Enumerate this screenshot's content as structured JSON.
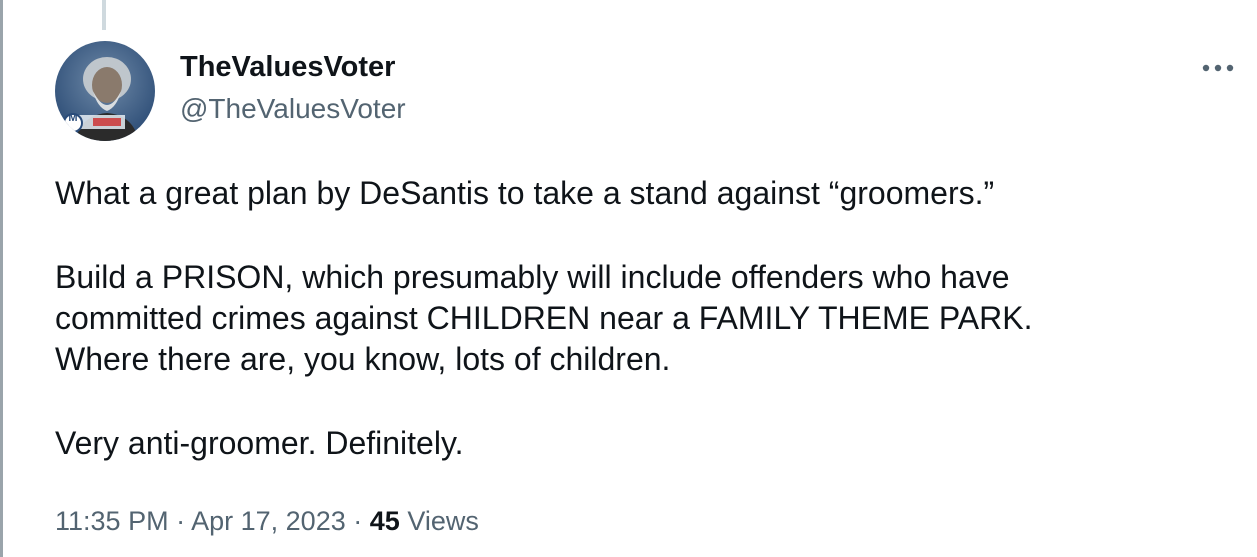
{
  "author": {
    "display_name": "TheValuesVoter",
    "handle": "@TheValuesVoter",
    "avatar_badge": "M"
  },
  "more_icon": "more-horizontal-icon",
  "tweet": {
    "paragraphs": [
      [
        "What a great plan by DeSantis to take a stand against “groomers.”"
      ],
      [
        "Build a PRISON, which presumably will include offenders who have",
        "committed crimes against CHILDREN near a FAMILY THEME PARK.",
        "Where there are, you know, lots of children."
      ],
      [
        "Very anti-groomer. Definitely."
      ]
    ]
  },
  "meta": {
    "time": "11:35 PM",
    "separator": "·",
    "date": "Apr 17, 2023",
    "views_count": "45",
    "views_label": "Views"
  },
  "colors": {
    "text_primary": "#0f1419",
    "text_secondary": "#536471",
    "thread_line": "#cfd9de"
  }
}
